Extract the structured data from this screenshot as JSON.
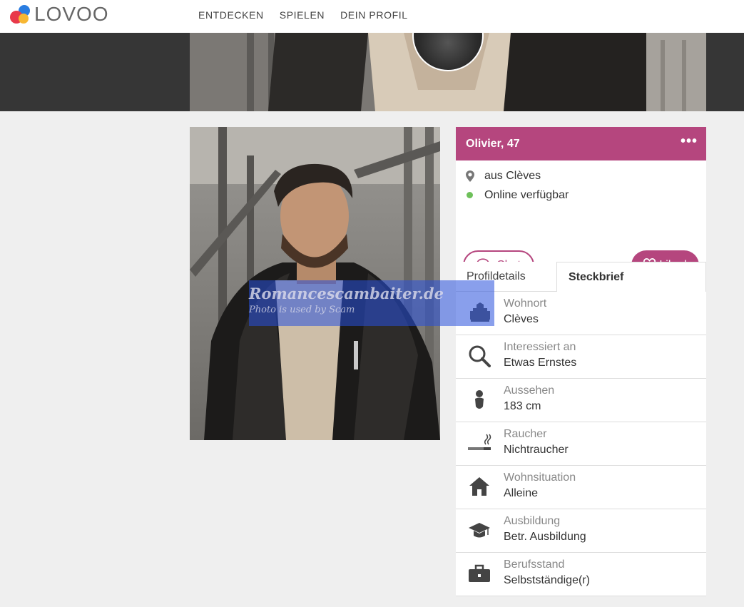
{
  "brand": {
    "name": "LOVOO",
    "colors": {
      "accent": "#b5467e",
      "online": "#6ec05a"
    }
  },
  "nav": {
    "items": [
      "ENTDECKEN",
      "SPIELEN",
      "DEIN PROFIL"
    ]
  },
  "watermark": {
    "title": "Romancescambaiter.de",
    "subtitle": "Photo is used by Scam"
  },
  "profile": {
    "name_age": "Olivier, 47",
    "menu_icon": "more-dots-icon",
    "location": "aus Clèves",
    "status": "Online verfügbar",
    "chat_label": "Chat",
    "liked_label": "Liked"
  },
  "tabs": {
    "details": "Profildetails",
    "steckbrief": "Steckbrief",
    "active": "Steckbrief"
  },
  "facts": [
    {
      "icon": "building-icon",
      "label": "Wohnort",
      "value": "Clèves"
    },
    {
      "icon": "search-icon",
      "label": "Interessiert an",
      "value": "Etwas Ernstes"
    },
    {
      "icon": "person-icon",
      "label": "Aussehen",
      "value": "183 cm"
    },
    {
      "icon": "cigarette-icon",
      "label": "Raucher",
      "value": "Nichtraucher"
    },
    {
      "icon": "house-icon",
      "label": "Wohnsituation",
      "value": "Alleine"
    },
    {
      "icon": "graduation-cap-icon",
      "label": "Ausbildung",
      "value": "Betr. Ausbildung"
    },
    {
      "icon": "briefcase-icon",
      "label": "Berufsstand",
      "value": "Selbstständige(r)"
    }
  ]
}
